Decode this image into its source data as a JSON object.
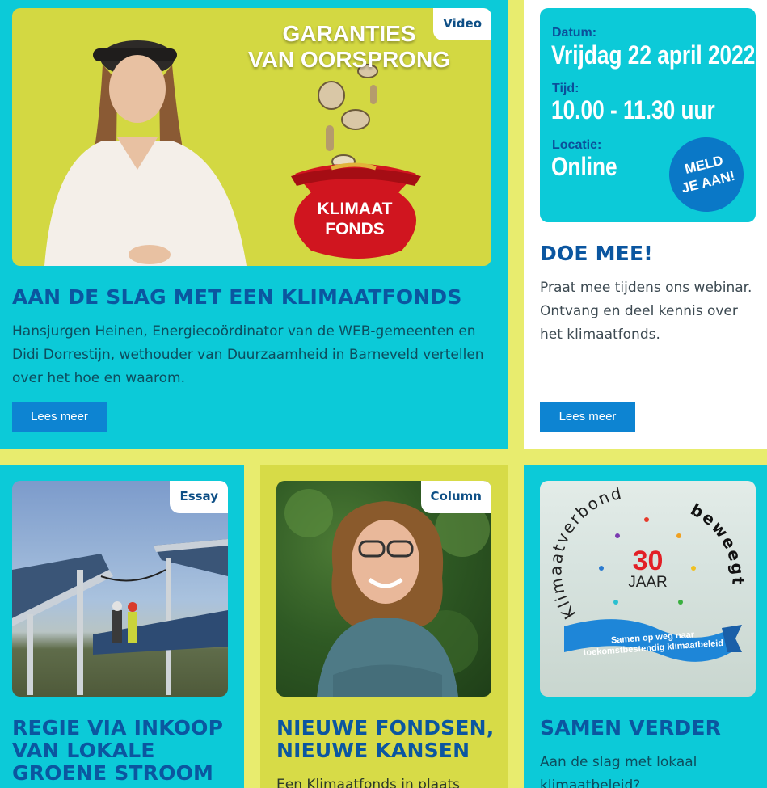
{
  "featured": {
    "tag": "Video",
    "image_caption_line1": "GARANTIES",
    "image_caption_line2": "VAN OORSPRONG",
    "bag_label_line1": "KLIMAAT",
    "bag_label_line2": "FONDS",
    "title": "AAN DE SLAG MET EEN KLIMAATFONDS",
    "description": "Hansjurgen Heinen, Energiecoördinator van de WEB-gemeenten en Didi Dorrestijn, wethouder van Duurzaamheid in Barneveld vertellen over het hoe en waarom.",
    "button": "Lees meer"
  },
  "event": {
    "date_label": "Datum:",
    "date_value": "Vrijdag 22 april 2022",
    "time_label": "Tijd:",
    "time_value": "10.00 - 11.30 uur",
    "location_label": "Locatie:",
    "location_value": "Online",
    "signup_line1": "MELD",
    "signup_line2": "JE AAN!",
    "title": "DOE MEE!",
    "description": "Praat mee tijdens ons webinar. Ontvang en deel kennis over het klimaatfonds.",
    "button": "Lees meer"
  },
  "essay": {
    "tag": "Essay",
    "title_line1": "REGIE VIA INKOOP",
    "title_line2": "VAN LOKALE",
    "title_line3": "GROENE STROOM"
  },
  "column": {
    "tag": "Column",
    "title_line1": "NIEUWE FONDSEN,",
    "title_line2": "NIEUWE KANSEN",
    "description": "Een Klimaatfonds in plaats"
  },
  "anniversary": {
    "arc_left": "Klimaatverbond",
    "arc_right": "beweegt",
    "number": "30",
    "unit": "JAAR",
    "ribbon_line1": "Samen op weg naar",
    "ribbon_line2": "toekomstbestendig klimaatbeleid",
    "title": "SAMEN VERDER",
    "description_line1": "Aan de slag met lokaal",
    "description_line2": "klimaatbeleid?"
  }
}
